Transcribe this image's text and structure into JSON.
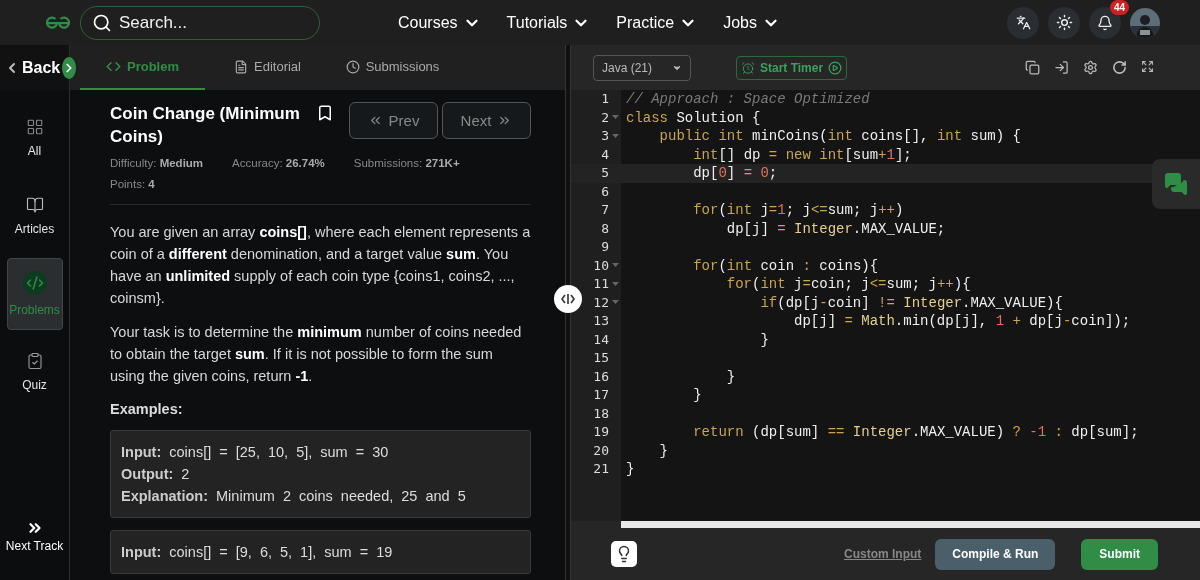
{
  "nav": {
    "search": {
      "placeholder": "Search..."
    },
    "links": [
      {
        "label": "Courses"
      },
      {
        "label": "Tutorials"
      },
      {
        "label": "Practice"
      },
      {
        "label": "Jobs"
      }
    ],
    "notification_count": "44"
  },
  "sidebar": {
    "back": "Back",
    "items": [
      {
        "label": "All",
        "kind": "grid",
        "selected": false
      },
      {
        "label": "Articles",
        "kind": "book",
        "selected": false
      },
      {
        "label": "Problems",
        "kind": "code",
        "selected": true
      },
      {
        "label": "Quiz",
        "kind": "clipboard",
        "selected": false
      }
    ],
    "next_track": "Next Track"
  },
  "tabs": [
    {
      "label": "Problem",
      "kind": "code",
      "selected": true
    },
    {
      "label": "Editorial",
      "kind": "doc",
      "selected": false
    },
    {
      "label": "Submissions",
      "kind": "clock",
      "selected": false
    }
  ],
  "problem": {
    "title": "Coin Change (Minimum Coins)",
    "prev": "Prev",
    "next": "Next",
    "meta_rows": [
      [
        "Difficulty: **Medium**",
        "Accuracy: **26.74%**",
        "Submissions: **271K+**"
      ],
      [
        "Points: **4**"
      ]
    ],
    "paragraphs": [
      "You are given an array **coins[]**, where each element represents a coin of a **different** denomination, and a target value **sum**. You have an **unlimited** supply of each coin type {coins1, coins2, ..., coinsm}.",
      "Your task is to determine the **minimum** number of coins needed to obtain the target **sum**. If it is not possible to form the sum using the given coins, return **-1**."
    ],
    "examples_heading": "Examples:",
    "examples": [
      {
        "lines": [
          "**Input:** coins[] = [25, 10, 5], sum = 30",
          "**Output:** 2",
          "**Explanation:** Minimum 2 coins needed, 25 and 5"
        ]
      },
      {
        "lines": [
          "**Input:** coins[] = [9, 6, 5, 1], sum = 19"
        ]
      }
    ]
  },
  "editor": {
    "language": "Java (21)",
    "timer": "Start Timer",
    "lines": [
      {
        "number": "1",
        "foldable": false,
        "current": false,
        "tokens": [
          {
            "kind": "comment",
            "text": "// Approach : Space Optimized"
          }
        ]
      },
      {
        "number": "2",
        "foldable": true,
        "current": false,
        "tokens": [
          {
            "kind": "keyword",
            "text": "class"
          },
          {
            "kind": "plain",
            "text": " Solution {"
          }
        ]
      },
      {
        "number": "3",
        "foldable": true,
        "current": false,
        "tokens": [
          {
            "kind": "keyword",
            "text": "    public"
          },
          {
            "kind": "keyword",
            "text": " int"
          },
          {
            "kind": "plain",
            "text": " minCoins("
          },
          {
            "kind": "keyword",
            "text": "int"
          },
          {
            "kind": "plain",
            "text": " coins[], "
          },
          {
            "kind": "keyword",
            "text": "int"
          },
          {
            "kind": "plain",
            "text": " sum) {"
          }
        ]
      },
      {
        "number": "4",
        "foldable": false,
        "current": false,
        "tokens": [
          {
            "kind": "keyword",
            "text": "        int"
          },
          {
            "kind": "plain",
            "text": "[] dp "
          },
          {
            "kind": "operator",
            "text": "="
          },
          {
            "kind": "keyword",
            "text": " new"
          },
          {
            "kind": "keyword",
            "text": " int"
          },
          {
            "kind": "plain",
            "text": "[sum"
          },
          {
            "kind": "operator",
            "text": "+"
          },
          {
            "kind": "number",
            "text": "1"
          },
          {
            "kind": "plain",
            "text": "];"
          }
        ]
      },
      {
        "number": "5",
        "foldable": false,
        "current": true,
        "tokens": [
          {
            "kind": "plain",
            "text": "        dp["
          },
          {
            "kind": "number",
            "text": "0"
          },
          {
            "kind": "plain",
            "text": "] "
          },
          {
            "kind": "operator",
            "text": "="
          },
          {
            "kind": "number",
            "text": " 0"
          },
          {
            "kind": "plain",
            "text": ";"
          }
        ]
      },
      {
        "number": "6",
        "foldable": false,
        "current": false
      },
      {
        "number": "7",
        "foldable": false,
        "current": false,
        "tokens": [
          {
            "kind": "keyword",
            "text": "        for"
          },
          {
            "kind": "plain",
            "text": "("
          },
          {
            "kind": "keyword",
            "text": "int"
          },
          {
            "kind": "plain",
            "text": " j"
          },
          {
            "kind": "operator",
            "text": "="
          },
          {
            "kind": "number",
            "text": "1"
          },
          {
            "kind": "plain",
            "text": "; j"
          },
          {
            "kind": "operator",
            "text": "<="
          },
          {
            "kind": "plain",
            "text": "sum; j"
          },
          {
            "kind": "operator",
            "text": "++"
          },
          {
            "kind": "plain",
            "text": ")"
          }
        ]
      },
      {
        "number": "8",
        "foldable": false,
        "current": false,
        "tokens": [
          {
            "kind": "plain",
            "text": "            dp[j] "
          },
          {
            "kind": "operator",
            "text": "="
          },
          {
            "kind": "class",
            "text": " Integer"
          },
          {
            "kind": "plain",
            "text": ".MAX_VALUE;"
          }
        ]
      },
      {
        "number": "9",
        "foldable": false,
        "current": false
      },
      {
        "number": "10",
        "foldable": true,
        "current": false,
        "tokens": [
          {
            "kind": "keyword",
            "text": "        for"
          },
          {
            "kind": "plain",
            "text": "("
          },
          {
            "kind": "keyword",
            "text": "int"
          },
          {
            "kind": "plain",
            "text": " coin "
          },
          {
            "kind": "operator",
            "text": ":"
          },
          {
            "kind": "plain",
            "text": " coins){"
          }
        ]
      },
      {
        "number": "11",
        "foldable": true,
        "current": false,
        "tokens": [
          {
            "kind": "keyword",
            "text": "            for"
          },
          {
            "kind": "plain",
            "text": "("
          },
          {
            "kind": "keyword",
            "text": "int"
          },
          {
            "kind": "plain",
            "text": " j"
          },
          {
            "kind": "operator",
            "text": "="
          },
          {
            "kind": "plain",
            "text": "coin; j"
          },
          {
            "kind": "operator",
            "text": "<="
          },
          {
            "kind": "plain",
            "text": "sum; j"
          },
          {
            "kind": "operator",
            "text": "++"
          },
          {
            "kind": "plain",
            "text": "){"
          }
        ]
      },
      {
        "number": "12",
        "foldable": true,
        "current": false,
        "tokens": [
          {
            "kind": "keyword",
            "text": "                if"
          },
          {
            "kind": "plain",
            "text": "(dp[j"
          },
          {
            "kind": "operator",
            "text": "-"
          },
          {
            "kind": "plain",
            "text": "coin] "
          },
          {
            "kind": "operator",
            "text": "!="
          },
          {
            "kind": "class",
            "text": " Integer"
          },
          {
            "kind": "plain",
            "text": ".MAX_VALUE){"
          }
        ]
      },
      {
        "number": "13",
        "foldable": false,
        "current": false,
        "tokens": [
          {
            "kind": "plain",
            "text": "                    dp[j] "
          },
          {
            "kind": "operator",
            "text": "="
          },
          {
            "kind": "class",
            "text": " Math"
          },
          {
            "kind": "plain",
            "text": ".min(dp[j], "
          },
          {
            "kind": "number",
            "text": "1"
          },
          {
            "kind": "operator",
            "text": " +"
          },
          {
            "kind": "plain",
            "text": " dp[j"
          },
          {
            "kind": "operator",
            "text": "-"
          },
          {
            "kind": "plain",
            "text": "coin]);"
          }
        ]
      },
      {
        "number": "14",
        "foldable": false,
        "current": false,
        "tokens": [
          {
            "kind": "plain",
            "text": "                }"
          }
        ]
      },
      {
        "number": "15",
        "foldable": false,
        "current": false
      },
      {
        "number": "16",
        "foldable": false,
        "current": false,
        "tokens": [
          {
            "kind": "plain",
            "text": "            }"
          }
        ]
      },
      {
        "number": "17",
        "foldable": false,
        "current": false,
        "tokens": [
          {
            "kind": "plain",
            "text": "        }"
          }
        ]
      },
      {
        "number": "18",
        "foldable": false,
        "current": false
      },
      {
        "number": "19",
        "foldable": false,
        "current": false,
        "tokens": [
          {
            "kind": "keyword",
            "text": "        return"
          },
          {
            "kind": "plain",
            "text": " (dp[sum] "
          },
          {
            "kind": "operator",
            "text": "=="
          },
          {
            "kind": "class",
            "text": " Integer"
          },
          {
            "kind": "plain",
            "text": ".MAX_VALUE) "
          },
          {
            "kind": "operator",
            "text": "?"
          },
          {
            "kind": "number",
            "text": " -1"
          },
          {
            "kind": "operator",
            "text": " :"
          },
          {
            "kind": "plain",
            "text": " dp[sum];"
          }
        ]
      },
      {
        "number": "20",
        "foldable": false,
        "current": false,
        "tokens": [
          {
            "kind": "plain",
            "text": "    }"
          }
        ]
      },
      {
        "number": "21",
        "foldable": false,
        "current": false,
        "tokens": [
          {
            "kind": "plain",
            "text": "}"
          }
        ]
      }
    ]
  },
  "footer": {
    "custom_input": "Custom Input",
    "compile": "Compile & Run",
    "submit": "Submit"
  }
}
